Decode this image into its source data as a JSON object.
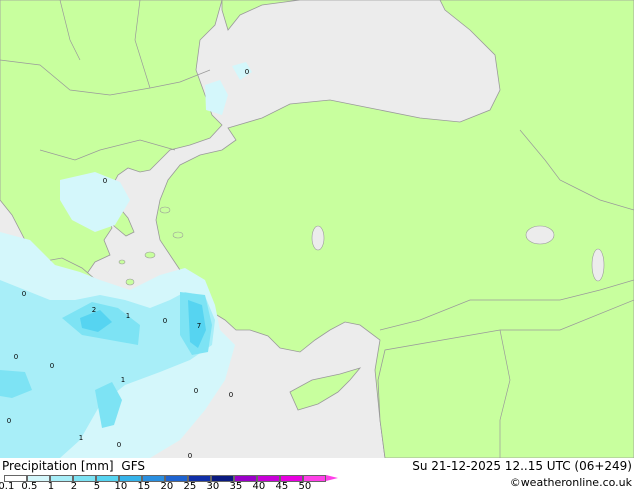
{
  "header": {
    "title": "Precipitation [mm]",
    "model": "GFS",
    "valid_time": "Su 21-12-2025 12..15 UTC (06+249)",
    "credit": "©weatheronline.co.uk"
  },
  "legend": {
    "ticks": [
      "0.1",
      "0.5",
      "1",
      "2",
      "5",
      "10",
      "15",
      "20",
      "25",
      "30",
      "35",
      "40",
      "45",
      "50"
    ],
    "colors": [
      "#ffffff",
      "#d4f7fb",
      "#a8eef8",
      "#7de3f4",
      "#56d4f1",
      "#35b3ea",
      "#2a8fe0",
      "#1e63d0",
      "#102fa8",
      "#0a1a80",
      "#9a00c8",
      "#c800d8",
      "#e800e0",
      "#ff40e8"
    ]
  },
  "map": {
    "colors": {
      "land": "#c8ff9e",
      "sea": "#ececec",
      "border": "#9a9a9a",
      "rain_light": "#d4f7fb",
      "rain_mid": "#a8eef8",
      "rain_heavy": "#7de3f4",
      "rain_core": "#56d4f1"
    },
    "point_values": [
      "0",
      "0",
      "0",
      "0",
      "2",
      "1",
      "0",
      "7",
      "0",
      "0",
      "1",
      "0",
      "0",
      "1",
      "0",
      "0"
    ]
  }
}
